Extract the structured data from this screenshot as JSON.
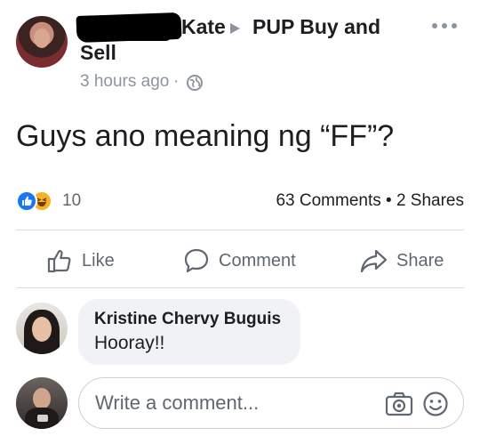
{
  "post": {
    "author": "Kate",
    "group_line1": "PUP Buy and",
    "group_line2": "Sell",
    "timestamp": "3 hours ago",
    "separator": "·",
    "text": "Guys ano meaning ng “FF”?"
  },
  "stats": {
    "reaction_count": "10",
    "comments_shares": "63 Comments • 2 Shares",
    "reactions": [
      "like-icon",
      "haha-icon"
    ]
  },
  "actions": {
    "like": "Like",
    "comment": "Comment",
    "share": "Share"
  },
  "comment": {
    "name": "Kristine Chervy Buguis",
    "text": "Hooray!!"
  },
  "composer": {
    "placeholder": "Write a comment..."
  },
  "colors": {
    "accent": "#1877f2",
    "haha": "#f7b125",
    "secondary_text": "#606770"
  }
}
